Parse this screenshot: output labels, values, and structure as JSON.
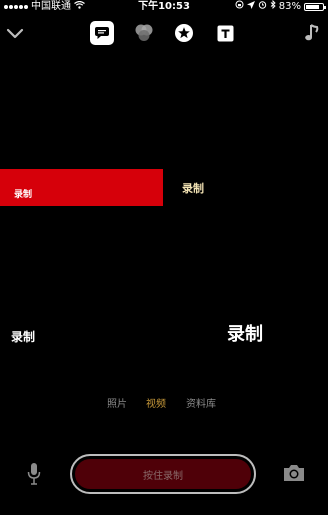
{
  "status_bar": {
    "carrier": "中国联通",
    "time": "下午10:53",
    "battery": "83%",
    "battery_level": 0.83
  },
  "toolbar": {
    "icons": [
      "chevron-down-icon",
      "speech-bubble-icon",
      "color-circles-icon",
      "star-icon",
      "text-icon",
      "music-note-icon"
    ]
  },
  "canvas": {
    "banner_label": "录制",
    "gold_label": "录制",
    "left_label": "录制",
    "right_label": "录制",
    "banner_color": "#d6000a",
    "gold_color": "#f2e2b3"
  },
  "mode_tabs": [
    {
      "label": "照片",
      "active": false
    },
    {
      "label": "视频",
      "active": true
    },
    {
      "label": "资料库",
      "active": false
    }
  ],
  "bottom": {
    "record_label": "按住录制",
    "record_color": "#4f0008",
    "active_tab_color": "#c99a3a"
  }
}
